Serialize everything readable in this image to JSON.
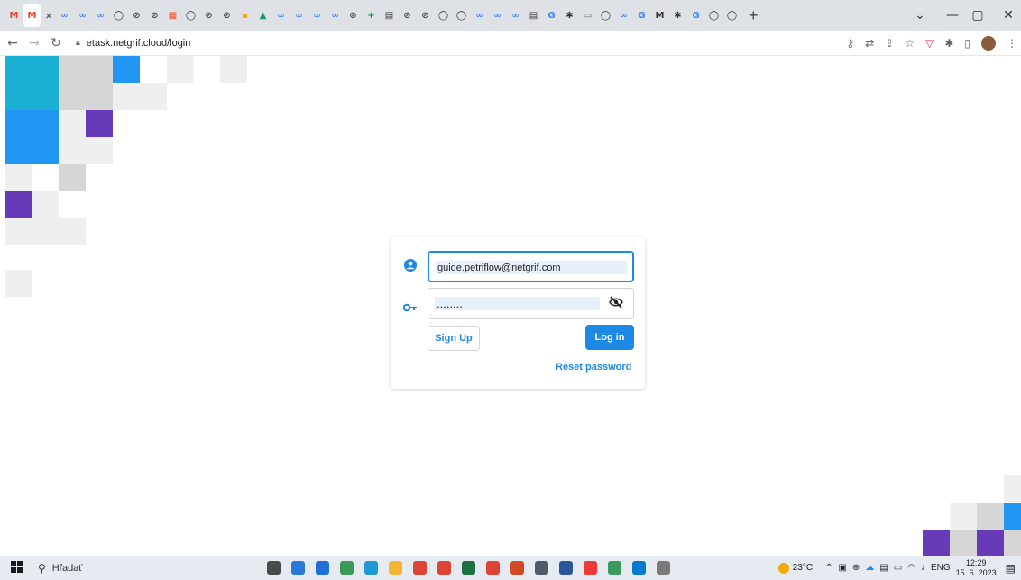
{
  "browser": {
    "tab_favicons": [
      {
        "icon": "gmail-icon",
        "glyph": "M",
        "color": "#ea4335"
      },
      {
        "icon": "gmail-icon",
        "glyph": "M",
        "color": "#ea4335",
        "active": true
      },
      {
        "icon": "netgrif-icon",
        "glyph": "∞",
        "color": "#4285f4"
      },
      {
        "icon": "netgrif-icon",
        "glyph": "∞",
        "color": "#4285f4"
      },
      {
        "icon": "netgrif-icon",
        "glyph": "∞",
        "color": "#4285f4"
      },
      {
        "icon": "github-icon",
        "glyph": "◯",
        "color": "#24292e"
      },
      {
        "icon": "circle-icon",
        "glyph": "⊘",
        "color": "#444444"
      },
      {
        "icon": "circle-icon",
        "glyph": "⊘",
        "color": "#444444"
      },
      {
        "icon": "windows-icon",
        "glyph": "▦",
        "color": "#f25022"
      },
      {
        "icon": "github-icon",
        "glyph": "◯",
        "color": "#24292e"
      },
      {
        "icon": "circle-icon",
        "glyph": "⊘",
        "color": "#444444"
      },
      {
        "icon": "circle-icon",
        "glyph": "⊘",
        "color": "#444444"
      },
      {
        "icon": "meet-icon",
        "glyph": "▪",
        "color": "#f9ab00"
      },
      {
        "icon": "drive-icon",
        "glyph": "▲",
        "color": "#0f9d58"
      },
      {
        "icon": "netgrif-icon",
        "glyph": "∞",
        "color": "#4285f4"
      },
      {
        "icon": "netgrif-icon",
        "glyph": "∞",
        "color": "#4285f4"
      },
      {
        "icon": "netgrif-icon",
        "glyph": "∞",
        "color": "#4285f4"
      },
      {
        "icon": "netgrif-icon",
        "glyph": "∞",
        "color": "#4285f4"
      },
      {
        "icon": "circle-icon",
        "glyph": "⊘",
        "color": "#444444"
      },
      {
        "icon": "sheets-icon",
        "glyph": "+",
        "color": "#0f9d58"
      },
      {
        "icon": "doc-icon",
        "glyph": "▤",
        "color": "#333333"
      },
      {
        "icon": "circle-icon",
        "glyph": "⊘",
        "color": "#444444"
      },
      {
        "icon": "circle-icon",
        "glyph": "⊘",
        "color": "#444444"
      },
      {
        "icon": "github-icon",
        "glyph": "◯",
        "color": "#24292e"
      },
      {
        "icon": "github-icon",
        "glyph": "◯",
        "color": "#24292e"
      },
      {
        "icon": "netgrif-icon",
        "glyph": "∞",
        "color": "#4285f4"
      },
      {
        "icon": "netgrif-icon",
        "glyph": "∞",
        "color": "#4285f4"
      },
      {
        "icon": "netgrif-icon",
        "glyph": "∞",
        "color": "#4285f4"
      },
      {
        "icon": "doc-icon",
        "glyph": "▤",
        "color": "#333333"
      },
      {
        "icon": "google-icon",
        "glyph": "G",
        "color": "#4285f4"
      },
      {
        "icon": "chatgpt-icon",
        "glyph": "✱",
        "color": "#333333"
      },
      {
        "icon": "image-icon",
        "glyph": "▭",
        "color": "#555555"
      },
      {
        "icon": "github-icon",
        "glyph": "◯",
        "color": "#24292e"
      },
      {
        "icon": "netgrif-icon",
        "glyph": "∞",
        "color": "#4285f4"
      },
      {
        "icon": "google-icon",
        "glyph": "G",
        "color": "#4285f4"
      },
      {
        "icon": "md-icon",
        "glyph": "M",
        "color": "#333333"
      },
      {
        "icon": "chatgpt-icon",
        "glyph": "✱",
        "color": "#333333"
      },
      {
        "icon": "google-icon",
        "glyph": "G",
        "color": "#4285f4"
      },
      {
        "icon": "github-icon",
        "glyph": "◯",
        "color": "#24292e"
      },
      {
        "icon": "github-icon",
        "glyph": "◯",
        "color": "#24292e"
      }
    ],
    "url": "etask.netgrif.cloud/login"
  },
  "login": {
    "email_value": "guide.petriflow@netgrif.com",
    "password_value": "........",
    "signup_label": "Sign Up",
    "login_label": "Log in",
    "reset_label": "Reset password"
  },
  "taskbar": {
    "search_placeholder": "Hľadať",
    "weather": "23°C",
    "language": "ENG",
    "time": "12:29",
    "date": "15. 6. 2023",
    "apps": [
      {
        "icon": "task-view-icon",
        "color": "#4a4a4a"
      },
      {
        "icon": "store-icon",
        "color": "#2b79d6"
      },
      {
        "icon": "mail-icon",
        "color": "#1e6fd9"
      },
      {
        "icon": "chrome-badge-icon",
        "color": "#3a9a5c"
      },
      {
        "icon": "edge-icon",
        "color": "#1f9ad6"
      },
      {
        "icon": "file-explorer-icon",
        "color": "#f2b632"
      },
      {
        "icon": "chrome-icon",
        "color": "#db4437"
      },
      {
        "icon": "chrome-icon",
        "color": "#db4437"
      },
      {
        "icon": "excel-icon",
        "color": "#1d7044"
      },
      {
        "icon": "chrome-icon",
        "color": "#db4437"
      },
      {
        "icon": "powerpoint-icon",
        "color": "#d24726"
      },
      {
        "icon": "calculator-icon",
        "color": "#4f5b66"
      },
      {
        "icon": "word-icon",
        "color": "#2b579a"
      },
      {
        "icon": "vivaldi-icon",
        "color": "#ef3939"
      },
      {
        "icon": "notepad-icon",
        "color": "#3a9a5c"
      },
      {
        "icon": "vscode-icon",
        "color": "#007acc"
      },
      {
        "icon": "paint-icon",
        "color": "#7a7a7a"
      }
    ]
  }
}
